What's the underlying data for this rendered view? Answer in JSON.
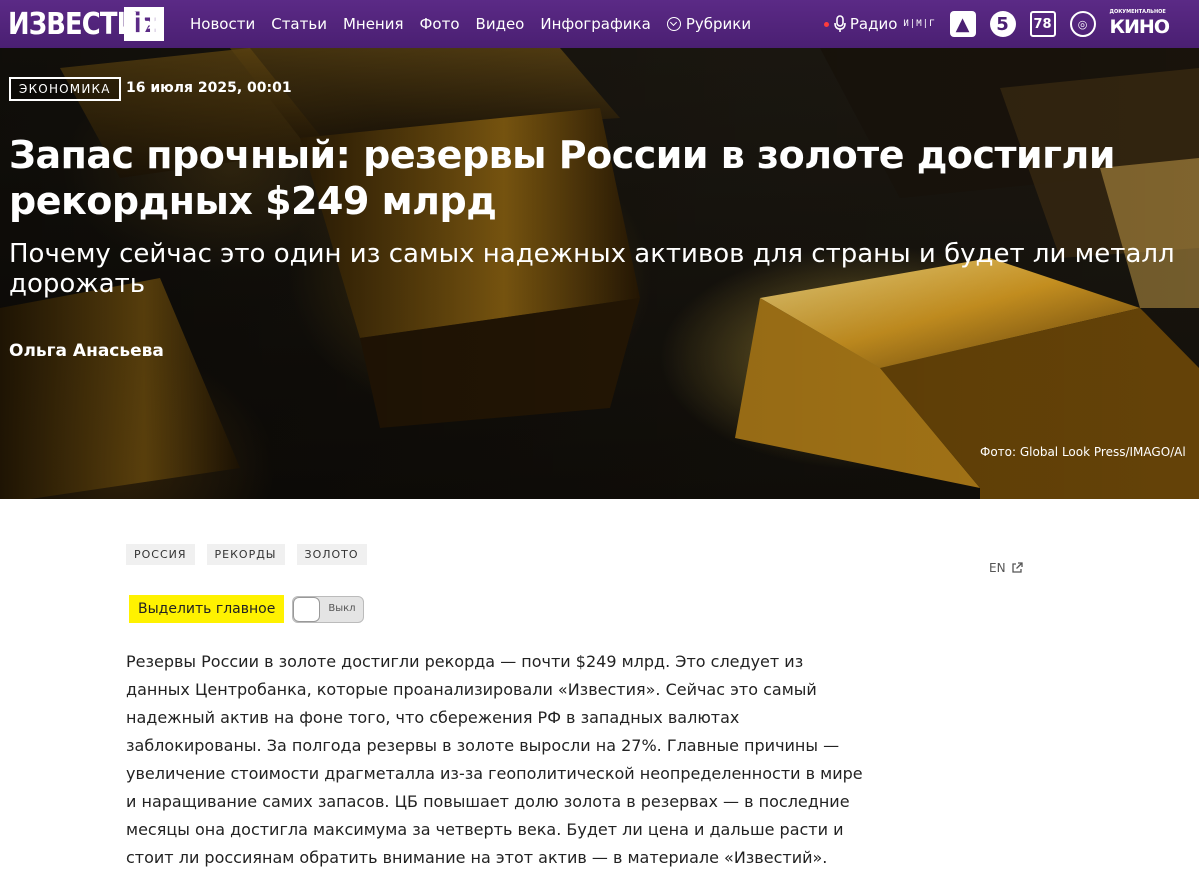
{
  "header": {
    "logo_text": "ИЗВЕСТИЯ",
    "logo_badge": "iz",
    "nav": [
      "Новости",
      "Статьи",
      "Мнения",
      "Фото",
      "Видео",
      "Инфографика"
    ],
    "rubrics_label": "Рубрики",
    "radio_label": "Радио",
    "radio_sub": "И|М|Г",
    "channels": {
      "ch1": "▲",
      "ch5": "5",
      "ch78": "78",
      "ch_round": "◎",
      "kino_small": "ДОКУМЕНТАЛЬНОЕ",
      "kino": "КИНО"
    }
  },
  "hero": {
    "category": "ЭКОНОМИКА",
    "date": "16 июля 2025, 00:01",
    "title": "Запас прочный: резервы России в золоте достигли рекордных $249 млрд",
    "subtitle": "Почему сейчас это один из самых надежных активов для страны и будет ли металл дорожать",
    "author": "Ольга Анасьева",
    "photo_credit": "Фото: Global Look Press/IMAGO/Al"
  },
  "article": {
    "tags": [
      "РОССИЯ",
      "РЕКОРДЫ",
      "ЗОЛОТО"
    ],
    "lang_link": "EN",
    "highlight_label": "Выделить главное",
    "toggle_state": "Выкл",
    "lead": "Резервы России в золоте достигли рекорда — почти $249 млрд. Это следует из данных Центробанка, которые проанализировали «Известия». Сейчас это самый надежный актив на фоне того, что сбережения РФ в западных валютах заблокированы. За полгода резервы в золоте выросли на 27%. Главные причины — увеличение стоимости драгметалла из-за геополитической неопределенности в мире и наращивание самих запасов. ЦБ повышает долю золота в резервах — в последние месяцы она достигла максимума за четверть века. Будет ли цена и дальше расти и стоит ли россиянам обратить внимание на этот актив — в материале «Известий»."
  },
  "colors": {
    "header_bg": "#4a1f72",
    "highlight": "#fff200",
    "gold": "#d8a830"
  }
}
